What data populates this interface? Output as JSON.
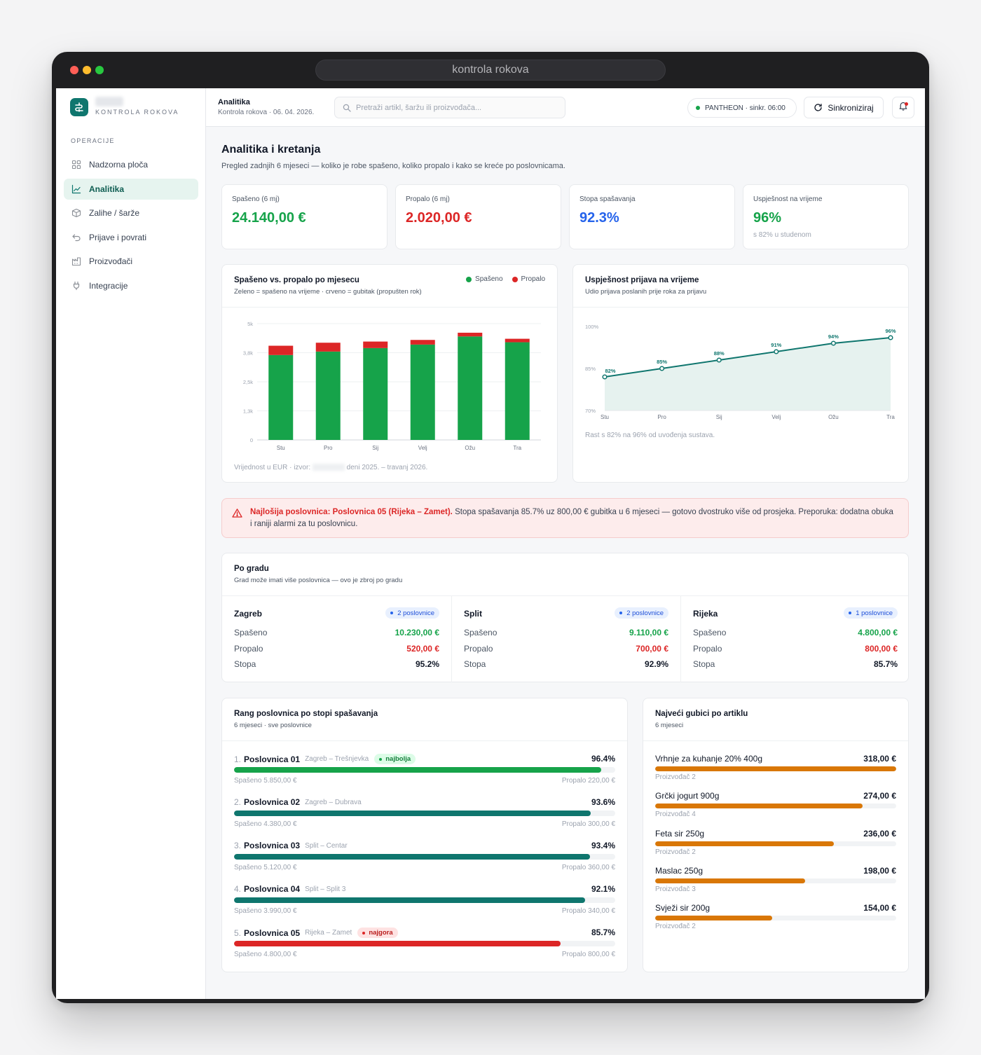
{
  "window": {
    "url": "kontrola rokova"
  },
  "sidebar": {
    "brand_sub": "KONTROLA ROKOVA",
    "section": "OPERACIJE",
    "items": [
      {
        "label": "Nadzorna ploča",
        "icon": "grid-icon",
        "active": false
      },
      {
        "label": "Analitika",
        "icon": "chart-line-icon",
        "active": true
      },
      {
        "label": "Zalihe / šarže",
        "icon": "box-icon",
        "active": false
      },
      {
        "label": "Prijave i povrati",
        "icon": "return-icon",
        "active": false
      },
      {
        "label": "Proizvođači",
        "icon": "factory-icon",
        "active": false
      },
      {
        "label": "Integracije",
        "icon": "plug-icon",
        "active": false
      }
    ]
  },
  "header": {
    "title": "Analitika",
    "subtitle": "Kontrola rokova · 06. 04. 2026.",
    "search_placeholder": "Pretraži artikl, šaržu ili proizvođača...",
    "sync_status": "PANTHEON · sinkr. 06:00",
    "sync_button": "Sinkroniziraj"
  },
  "page": {
    "title": "Analitika i kretanja",
    "subtitle": "Pregled zadnjih 6 mjeseci — koliko je robe spašeno, koliko propalo i kako se kreće po poslovnicama."
  },
  "kpis": [
    {
      "label": "Spašeno (6 mj)",
      "value": "24.140,00 €",
      "color": "#16a34a",
      "note": ""
    },
    {
      "label": "Propalo (6 mj)",
      "value": "2.020,00 €",
      "color": "#dc2626",
      "note": ""
    },
    {
      "label": "Stopa spašavanja",
      "value": "92.3%",
      "color": "#2563eb",
      "note": ""
    },
    {
      "label": "Uspješnost na vrijeme",
      "value": "96%",
      "color": "#16a34a",
      "note": "s 82% u studenom"
    }
  ],
  "bar_chart_card": {
    "title": "Spašeno vs. propalo po mjesecu",
    "subtitle": "Zeleno = spašeno na vrijeme · crveno = gubitak (propušten rok)",
    "legend": [
      "Spašeno",
      "Propalo"
    ],
    "footnote_left": "Vrijednost u EUR · izvor:",
    "footnote_right": "deni 2025. – travanj 2026."
  },
  "line_chart_card": {
    "title": "Uspješnost prijava na vrijeme",
    "subtitle": "Udio prijava poslanih prije roka za prijavu",
    "footnote": "Rast s 82% na 96% od uvođenja sustava."
  },
  "chart_data": [
    {
      "type": "bar",
      "stacked": true,
      "categories": [
        "Stu",
        "Pro",
        "Sij",
        "Velj",
        "Ožu",
        "Tra"
      ],
      "series": [
        {
          "name": "Spašeno",
          "color": "#16a34a",
          "values": [
            3650,
            3800,
            3950,
            4100,
            4450,
            4200
          ]
        },
        {
          "name": "Propalo",
          "color": "#dc2626",
          "values": [
            400,
            380,
            280,
            200,
            160,
            150
          ]
        }
      ],
      "y_ticks": [
        "0",
        "1,3k",
        "2,5k",
        "3,8k",
        "5k"
      ],
      "ylim": [
        0,
        5000
      ],
      "grid": true
    },
    {
      "type": "area",
      "categories": [
        "Stu",
        "Pro",
        "Sij",
        "Velj",
        "Ožu",
        "Tra"
      ],
      "values": [
        82,
        85,
        88,
        91,
        94,
        96
      ],
      "data_labels": [
        "82%",
        "85%",
        "88%",
        "91%",
        "94%",
        "96%"
      ],
      "y_ticks": [
        "70%",
        "85%",
        "100%"
      ],
      "ylim": [
        70,
        100
      ],
      "color": "#0f766e"
    }
  ],
  "alert": {
    "bold": "Najlošija poslovnica: Poslovnica 05 (Rijeka – Zamet).",
    "text": " Stopa spašavanja 85.7% uz 800,00 € gubitka u 6 mjeseci — gotovo dvostruko više od prosjeka. Preporuka: dodatna obuka i raniji alarmi za tu poslovnicu."
  },
  "by_city": {
    "title": "Po gradu",
    "subtitle": "Grad može imati više poslovnica — ovo je zbroj po gradu",
    "row_labels": [
      "Spašeno",
      "Propalo",
      "Stopa"
    ],
    "cities": [
      {
        "name": "Zagreb",
        "branches": "2 poslovnice",
        "saved": "10.230,00 €",
        "lost": "520,00 €",
        "rate": "95.2%"
      },
      {
        "name": "Split",
        "branches": "2 poslovnice",
        "saved": "9.110,00 €",
        "lost": "700,00 €",
        "rate": "92.9%"
      },
      {
        "name": "Rijeka",
        "branches": "1 poslovnice",
        "saved": "4.800,00 €",
        "lost": "800,00 €",
        "rate": "85.7%"
      }
    ]
  },
  "ranking": {
    "title": "Rang poslovnica po stopi spašavanja",
    "subtitle": "6 mjeseci · sve poslovnice",
    "rows": [
      {
        "num": "1.",
        "name": "Poslovnica 01",
        "location": "Zagreb – Trešnjevka",
        "tag": "najbolja",
        "tag_type": "best",
        "pct": "96.4%",
        "fill": 0.964,
        "color": "#16a34a",
        "saved": "Spašeno 5.850,00 €",
        "lost": "Propalo 220,00 €"
      },
      {
        "num": "2.",
        "name": "Poslovnica 02",
        "location": "Zagreb – Dubrava",
        "tag": "",
        "tag_type": "",
        "pct": "93.6%",
        "fill": 0.936,
        "color": "#0f766e",
        "saved": "Spašeno 4.380,00 €",
        "lost": "Propalo 300,00 €"
      },
      {
        "num": "3.",
        "name": "Poslovnica 03",
        "location": "Split – Centar",
        "tag": "",
        "tag_type": "",
        "pct": "93.4%",
        "fill": 0.934,
        "color": "#0f766e",
        "saved": "Spašeno 5.120,00 €",
        "lost": "Propalo 360,00 €"
      },
      {
        "num": "4.",
        "name": "Poslovnica 04",
        "location": "Split – Split 3",
        "tag": "",
        "tag_type": "",
        "pct": "92.1%",
        "fill": 0.921,
        "color": "#0f766e",
        "saved": "Spašeno 3.990,00 €",
        "lost": "Propalo 340,00 €"
      },
      {
        "num": "5.",
        "name": "Poslovnica 05",
        "location": "Rijeka – Zamet",
        "tag": "najgora",
        "tag_type": "worst",
        "pct": "85.7%",
        "fill": 0.857,
        "color": "#dc2626",
        "saved": "Spašeno 4.800,00 €",
        "lost": "Propalo 800,00 €"
      }
    ]
  },
  "losses": {
    "title": "Najveći gubici po artiklu",
    "subtitle": "6 mjeseci",
    "rows": [
      {
        "name": "Vrhnje za kuhanje 20% 400g",
        "value": "318,00 €",
        "amount": 318,
        "producer": "Proizvođač 2"
      },
      {
        "name": "Grčki jogurt 900g",
        "value": "274,00 €",
        "amount": 274,
        "producer": "Proizvođač 4"
      },
      {
        "name": "Feta sir 250g",
        "value": "236,00 €",
        "amount": 236,
        "producer": "Proizvođač 2"
      },
      {
        "name": "Maslac 250g",
        "value": "198,00 €",
        "amount": 198,
        "producer": "Proizvođač 3"
      },
      {
        "name": "Svježi sir 200g",
        "value": "154,00 €",
        "amount": 154,
        "producer": "Proizvođač 2"
      }
    ]
  }
}
